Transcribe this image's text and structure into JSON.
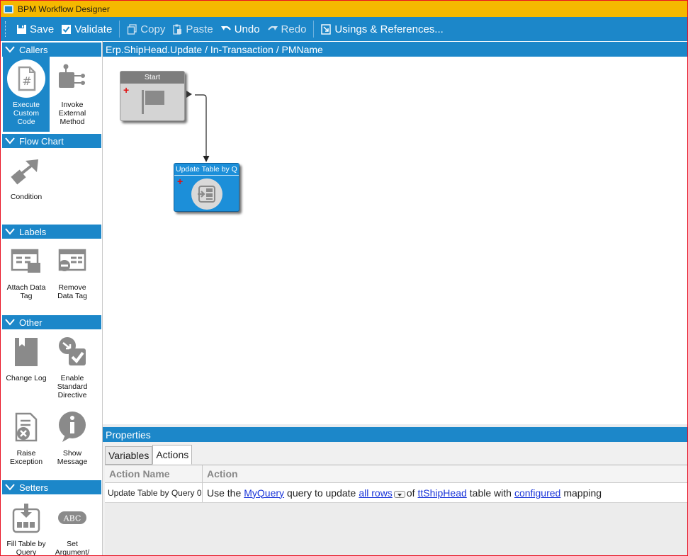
{
  "window": {
    "title": "BPM Workflow Designer"
  },
  "toolbar": {
    "save": "Save",
    "validate": "Validate",
    "copy": "Copy",
    "paste": "Paste",
    "undo": "Undo",
    "redo": "Redo",
    "usings": "Usings & References..."
  },
  "palette": {
    "callers": {
      "header": "Callers",
      "items": [
        "Execute Custom Code",
        "Invoke External Method"
      ]
    },
    "flowchart": {
      "header": "Flow Chart",
      "items": [
        "Condition"
      ]
    },
    "labels": {
      "header": "Labels",
      "items": [
        "Attach Data Tag",
        "Remove Data Tag"
      ]
    },
    "other": {
      "header": "Other",
      "items": [
        "Change Log",
        "Enable Standard Directive",
        "Raise Exception",
        "Show Message"
      ]
    },
    "setters": {
      "header": "Setters",
      "items": [
        "Fill Table by Query",
        "Set Argument/"
      ]
    }
  },
  "canvas": {
    "breadcrumb": "Erp.ShipHead.Update / In-Transaction / PMName",
    "nodes": {
      "start": "Start",
      "update": "Update Table by Q"
    }
  },
  "properties": {
    "header": "Properties",
    "tabs": [
      "Variables",
      "Actions"
    ],
    "active_tab": "Actions",
    "columns": [
      "Action Name",
      "Action"
    ],
    "rows": [
      {
        "name": "Update Table by Query 0",
        "t1": "Use the",
        "l1": "MyQuery",
        "t2": "query to update",
        "l2": "all rows",
        "t3": "of",
        "l3": "ttShipHead",
        "t4": "table with",
        "l4": "configured",
        "t5": "mapping"
      }
    ]
  },
  "colors": {
    "accent": "#1c87c9",
    "titlebar": "#f5b800",
    "link": "#1b36d9"
  }
}
